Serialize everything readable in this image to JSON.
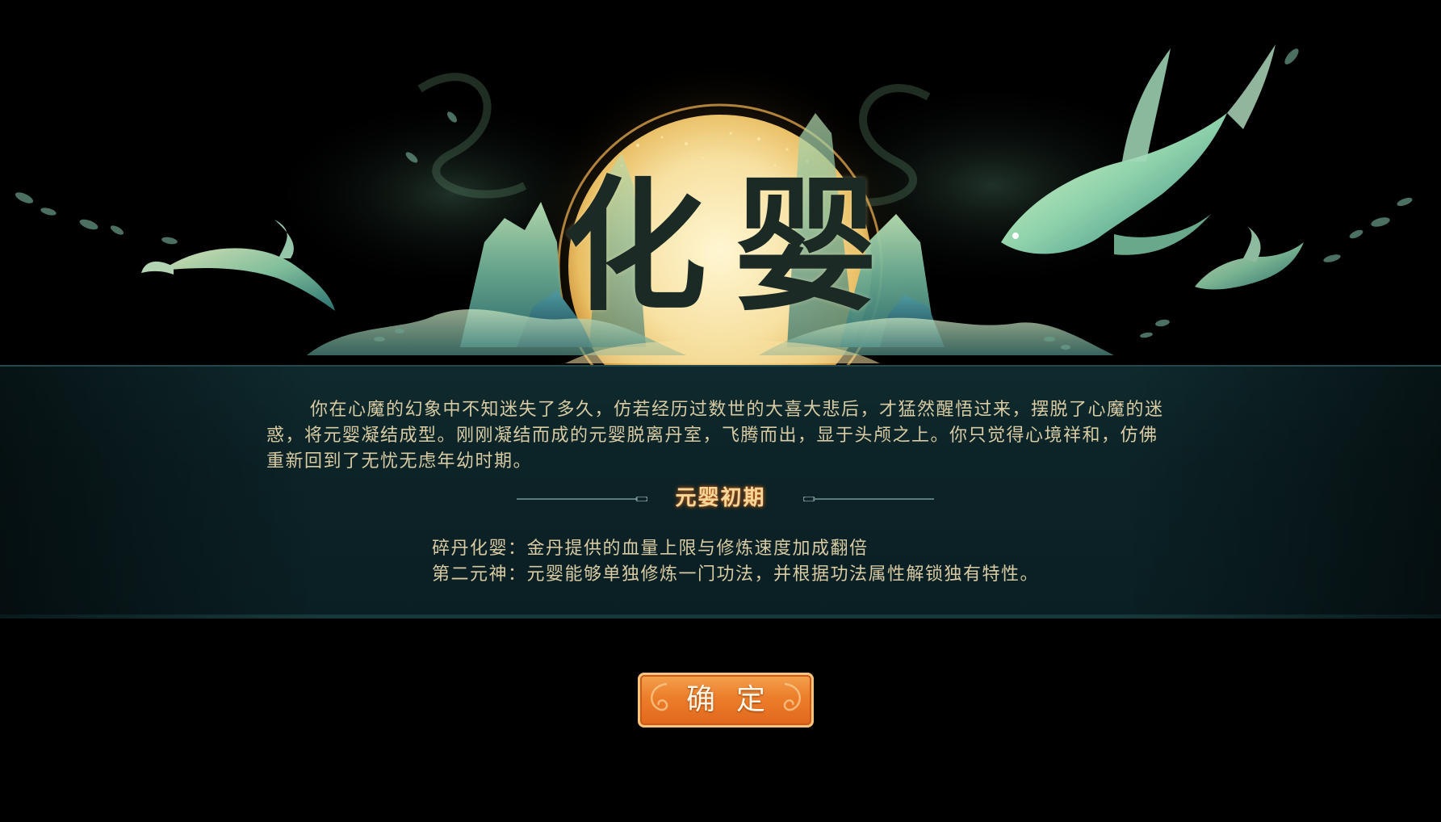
{
  "title": "化婴",
  "description": "你在心魔的幻象中不知迷失了多久，仿若经历过数世的大喜大悲后，才猛然醒悟过来，摆脱了心魔的迷惑，将元婴凝结成型。刚刚凝结而成的元婴脱离丹室，飞腾而出，显于头颅之上。你只觉得心境祥和，仿佛重新回到了无忧无虑年幼时期。",
  "stage_label": "元婴初期",
  "effects": [
    "碎丹化婴：金丹提供的血量上限与修炼速度加成翻倍",
    "第二元神：元婴能够单独修炼一门功法，并根据功法属性解锁独有特性。"
  ],
  "confirm_label": "确定",
  "icons": {
    "illustration": "moon-mountains-fish-art",
    "divider": "ornamental-line",
    "button_decor": "cloud-swirl-icon"
  },
  "colors": {
    "background": "#000000",
    "band": "#0c2327",
    "text": "#d8cba3",
    "stage_glow": "#c9621b",
    "button": "#ec7e2b",
    "moon": "#f6dc98",
    "jade": "#8fcfa8"
  }
}
